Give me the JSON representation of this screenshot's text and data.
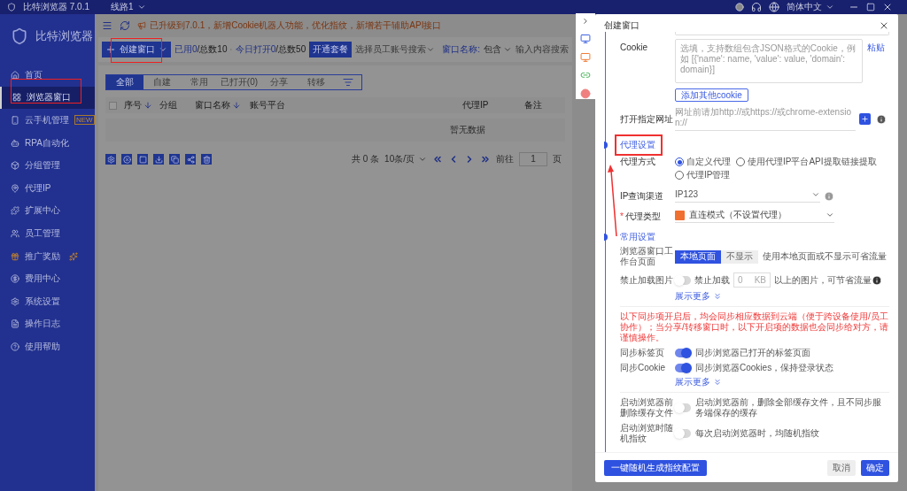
{
  "titlebar": {
    "app": "比特浏览器 7.0.1",
    "line": "线路1",
    "language": "简体中文"
  },
  "sidebar": {
    "brand": "比特浏览器",
    "items": [
      {
        "label": "首页",
        "selected": false,
        "highlight": false
      },
      {
        "label": "浏览器窗口",
        "selected": true,
        "highlight": false
      },
      {
        "label": "云手机管理",
        "selected": false,
        "highlight": false,
        "badge": "NEW"
      },
      {
        "label": "RPA自动化",
        "selected": false,
        "highlight": false
      },
      {
        "label": "分组管理",
        "selected": false,
        "highlight": false
      },
      {
        "label": "代理IP",
        "selected": false,
        "highlight": false
      },
      {
        "label": "扩展中心",
        "selected": false,
        "highlight": false
      },
      {
        "label": "员工管理",
        "selected": false,
        "highlight": false
      },
      {
        "label": "推广奖励",
        "selected": false,
        "highlight": true
      },
      {
        "label": "费用中心",
        "selected": false,
        "highlight": false
      },
      {
        "label": "系统设置",
        "selected": false,
        "highlight": false
      },
      {
        "label": "操作日志",
        "selected": false,
        "highlight": false
      },
      {
        "label": "使用帮助",
        "selected": false,
        "highlight": false
      }
    ]
  },
  "notice": "已升级到7.0.1，新增Cookie机器人功能，优化指纹，新增若干辅助API接口",
  "toolbar": {
    "create": "创建窗口",
    "used_label": "已用",
    "used": "0",
    "used_total": "/总数10",
    "opened_label": "今日打开",
    "opened": "0",
    "opened_total": "/总数50",
    "plan": "开通套餐",
    "staff_placeholder": "选择员工账号搜索",
    "name_label": "窗口名称:",
    "match": "包含",
    "search_placeholder": "输入内容搜索"
  },
  "tabs": [
    {
      "label": "全部",
      "selected": true
    },
    {
      "label": "自建",
      "selected": false
    },
    {
      "label": "常用",
      "selected": false
    },
    {
      "label": "已打开(0)",
      "selected": false
    },
    {
      "label": "分享",
      "selected": false
    },
    {
      "label": "转移",
      "selected": false
    }
  ],
  "table": {
    "select_all_checked": false,
    "columns": [
      {
        "label": "序号",
        "sortable": true
      },
      {
        "label": "分组",
        "sortable": false
      },
      {
        "label": "窗口名称",
        "sortable": true
      },
      {
        "label": "账号平台",
        "sortable": false
      },
      {
        "label": "代理IP",
        "sortable": false
      },
      {
        "label": "备注",
        "sortable": false
      }
    ],
    "empty": "暂无数据"
  },
  "pagination": {
    "total": "共 0 条",
    "size": "10条/页",
    "goto": "前往",
    "page": "1",
    "unit": "页"
  },
  "dialog": {
    "title": "创建窗口",
    "cookie": {
      "label": "Cookie",
      "placeholder": "选填，支持数组包含JSON格式的Cookie，例如 [{'name': name, 'value': value, 'domain': domain}]",
      "paste": "粘贴",
      "add": "添加其他cookie"
    },
    "url": {
      "label": "打开指定网址",
      "placeholder": "网址前请加http://或https://或chrome-extension://"
    },
    "proxy": {
      "heading": "代理设置",
      "method_label": "代理方式",
      "methods": [
        {
          "label": "自定义代理",
          "selected": true
        },
        {
          "label": "使用代理IP平台API提取链接提取",
          "selected": false
        },
        {
          "label": "代理IP管理",
          "selected": false
        }
      ],
      "channel_label": "IP查询渠道",
      "channel": "IP123",
      "type_required": true,
      "type_required_mark": "*",
      "type_label": "代理类型",
      "type": "直连模式（不设置代理）"
    },
    "common": {
      "heading": "常用设置",
      "workbench_label": "浏览器窗口工作台页面",
      "workbench_options": [
        {
          "label": "本地页面",
          "selected": true
        },
        {
          "label": "不显示",
          "selected": false
        }
      ],
      "workbench_hint": "使用本地页面或不显示可省流量",
      "images_label": "禁止加载图片",
      "images_on": false,
      "images_toggle": "禁止加载",
      "images_kb": "0",
      "images_unit": "KB",
      "images_hint": "以上的图片，可节省流量",
      "more": "展示更多"
    },
    "sync": {
      "warning": "以下同步项开启后，均会同步相应数据到云端（便于跨设备使用/员工协作）；当分享/转移窗口时，以下开启项的数据也会同步给对方，请谨慎操作。",
      "items": [
        {
          "label": "同步标签页",
          "on": true,
          "hint": "同步浏览器已打开的标签页面"
        },
        {
          "label": "同步Cookie",
          "on": true,
          "hint": "同步浏览器Cookies，保持登录状态"
        }
      ],
      "more": "展示更多"
    },
    "startup": [
      {
        "label": "启动浏览器前删除缓存文件",
        "on": false,
        "hint": "启动浏览器前，删除全部缓存文件，且不同步服务端保存的缓存"
      },
      {
        "label": "启动浏览时随机指纹",
        "on": false,
        "hint": "每次启动浏览器时，均随机指纹"
      }
    ],
    "footer": {
      "random": "一键随机生成指纹配置",
      "cancel": "取消",
      "ok": "确定"
    }
  }
}
